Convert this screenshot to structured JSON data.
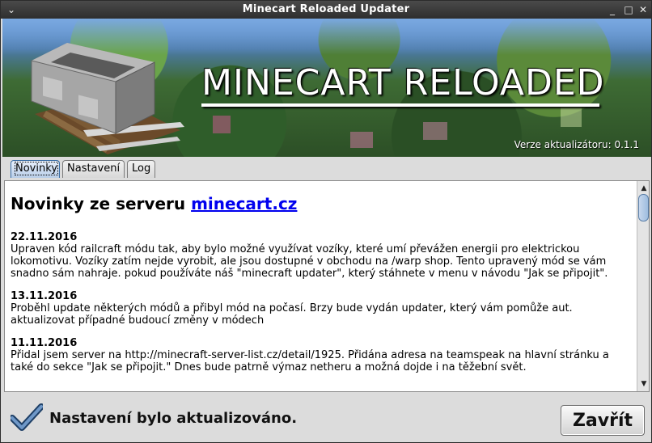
{
  "window": {
    "title": "Minecart Reloaded Updater"
  },
  "banner": {
    "title": "MINECART RELOADED",
    "version": "Verze aktualizátoru: 0.1.1"
  },
  "tabs": [
    {
      "label": "Novinky",
      "active": true
    },
    {
      "label": "Nastavení",
      "active": false
    },
    {
      "label": "Log",
      "active": false
    }
  ],
  "news": {
    "heading_prefix": "Novinky ze serveru ",
    "heading_link": "minecart.cz",
    "entries": [
      {
        "date": "22.11.2016",
        "text": "Upraven kód railcraft módu tak, aby bylo možné využívat vozíky, které umí převážen energii pro elektrickou lokomotivu. Vozíky zatím nejde vyrobit, ale jsou dostupné v obchodu na /warp shop. Tento upravený mód se vám snadno sám nahraje. pokud používáte náš \"minecraft updater\", který stáhnete v menu v návodu \"Jak se připojit\"."
      },
      {
        "date": "13.11.2016",
        "text": "Proběhl update některých módů a přibyl mód na počasí. Brzy bude vydán updater, který vám pomůže aut. aktualizovat případné budoucí změny v módech"
      },
      {
        "date": "11.11.2016",
        "text": "Přidal jsem server na http://minecraft-server-list.cz/detail/1925. Přidána adresa na teamspeak na hlavní stránku a také do sekce \"Jak se připojit.\" Dnes bude patrně výmaz netheru a možná dojde i na těžební svět."
      }
    ]
  },
  "status": {
    "icon": "checkmark-icon",
    "text": "Nastavení bylo aktualizováno.",
    "close_label": "Zavřít"
  }
}
